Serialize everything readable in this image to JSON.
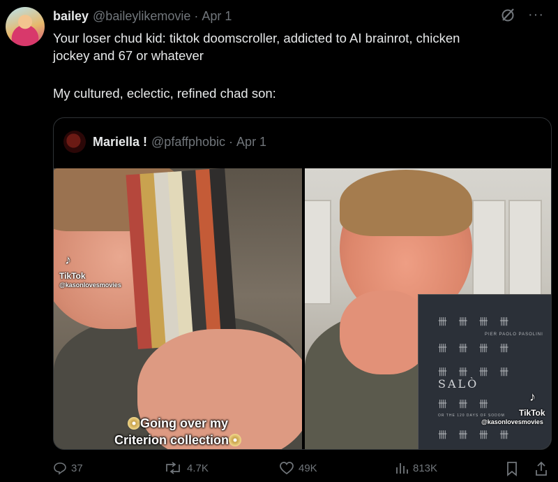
{
  "tweet": {
    "author_name": "bailey",
    "handle": "@baileylikemovie",
    "separator": "·",
    "date": "Apr 1",
    "text_line1": "Your loser chud kid: tiktok doomscroller, addicted to AI brainrot, chicken",
    "text_line2": "jockey and 67 or whatever",
    "text_line3": "My cultured, eclectic, refined chad son:"
  },
  "quote": {
    "author_name": "Mariella !",
    "handle": "@pfaffphobic",
    "separator": "·",
    "date": "Apr 1",
    "left_video": {
      "tiktok_label": "TikTok",
      "tiktok_user": "@kasonlovesmovies",
      "caption_line1": "Going over my",
      "caption_line2": "Criterion collection"
    },
    "right_video": {
      "tiktok_label": "TikTok",
      "tiktok_user": "@kasonlovesmovies",
      "book_title": "SALÒ",
      "book_top": "PIER PAOLO PASOLINI",
      "book_sub": "OR THE 120 DAYS OF SODOM"
    }
  },
  "actions": {
    "replies": "37",
    "reposts": "4.7K",
    "likes": "49K",
    "views": "813K"
  },
  "icons": [
    "grok-icon",
    "more-icon",
    "reply-icon",
    "repost-icon",
    "like-icon",
    "views-icon",
    "bookmark-icon",
    "share-icon",
    "tiktok-icon",
    "disc-icon"
  ],
  "colors": {
    "background": "#000000",
    "text": "#e7e9ea",
    "muted": "#71767b",
    "border": "#2f3336"
  }
}
